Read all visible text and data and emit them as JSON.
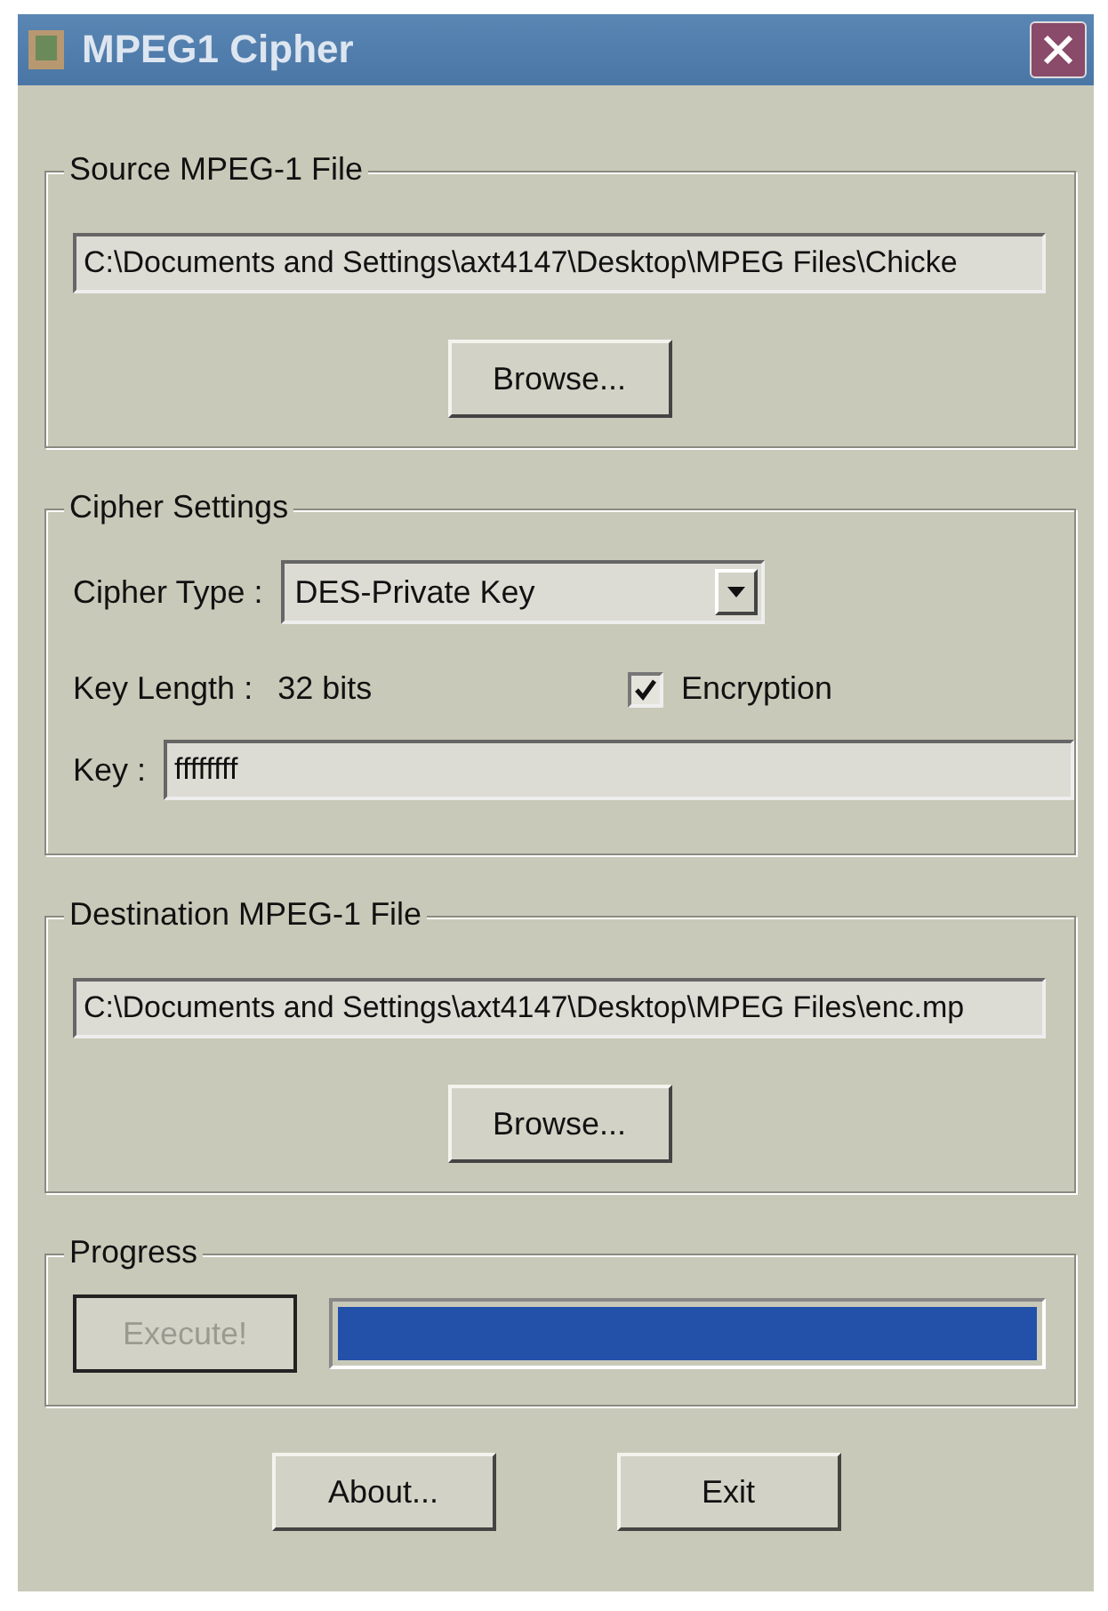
{
  "window": {
    "title": "MPEG1 Cipher"
  },
  "source": {
    "legend": "Source MPEG-1 File",
    "path": "C:\\Documents and Settings\\axt4147\\Desktop\\MPEG Files\\Chicke",
    "browse": "Browse..."
  },
  "cipher": {
    "legend": "Cipher Settings",
    "type_label": "Cipher Type :",
    "type_value": "DES-Private Key",
    "key_length_label": "Key Length :",
    "key_length": "32 bits",
    "encryption": {
      "label": "Encryption",
      "checked": true
    },
    "key_label": "Key :",
    "key": "ffffffff"
  },
  "destination": {
    "legend": "Destination MPEG-1 File",
    "path": "C:\\Documents and Settings\\axt4147\\Desktop\\MPEG Files\\enc.mp",
    "browse": "Browse..."
  },
  "progress": {
    "legend": "Progress",
    "execute": {
      "label": "Execute!",
      "disabled": true
    },
    "level": 1
  },
  "buttons": [
    "About...",
    "Exit"
  ]
}
